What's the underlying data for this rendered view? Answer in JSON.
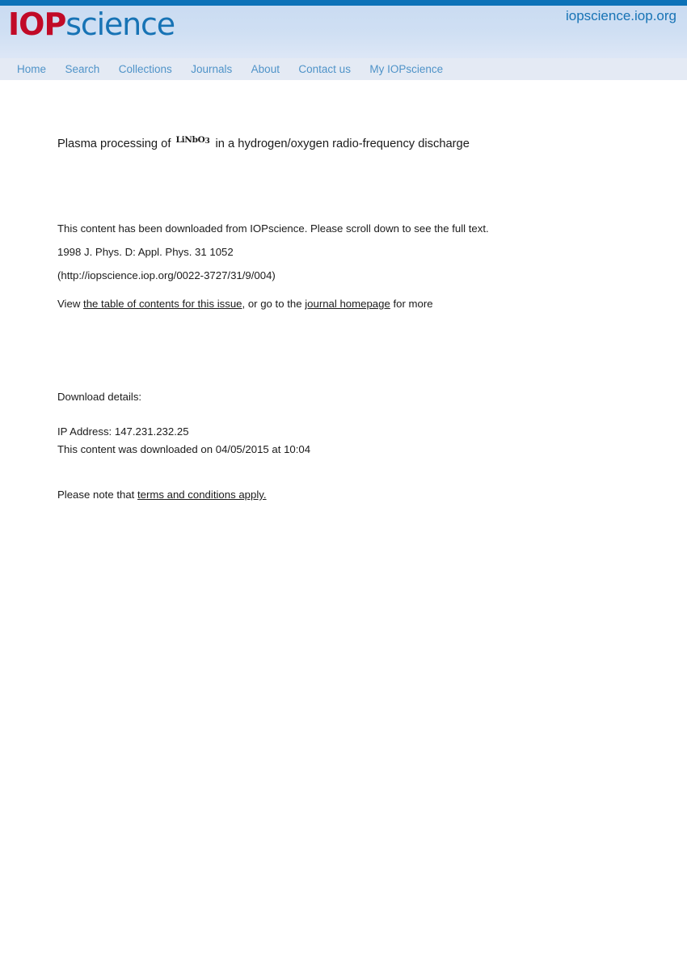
{
  "header": {
    "logo_primary": "IOP",
    "logo_secondary": "science",
    "site_url": "iopscience.iop.org",
    "top_rule_color": "#0c72b8",
    "band_color": "#cfdff3",
    "logo_primary_color": "#c10a27",
    "logo_secondary_color": "#1773b5"
  },
  "nav": {
    "link_color": "#4f93c8",
    "background_color": "#e4eaf4",
    "items": [
      {
        "label": "Home"
      },
      {
        "label": "Search"
      },
      {
        "label": "Collections"
      },
      {
        "label": "Journals"
      },
      {
        "label": "About"
      },
      {
        "label": "Contact us"
      },
      {
        "label": "My IOPscience"
      }
    ]
  },
  "article": {
    "title_before_formula": "Plasma processing of",
    "formula_main": "LiNbO",
    "formula_subscript": "3",
    "title_after_formula": "in a hydrogen/oxygen radio-frequency discharge"
  },
  "cover": {
    "downloaded_notice": "This content has been downloaded from IOPscience. Please scroll down to see the full text.",
    "citation": "1998 J. Phys. D: Appl. Phys. 31 1052",
    "doi_url": "(http://iopscience.iop.org/0022-3727/31/9/004)",
    "view_prefix": "View",
    "view_toc_link": "the table of contents for this issue",
    "view_middle": ", or go to the",
    "view_journal_link": "journal homepage",
    "view_suffix": "for more",
    "download_details_label": "Download details:",
    "ip_address": "IP Address: 147.231.232.25",
    "download_date": "This content was downloaded on 04/05/2015 at 10:04",
    "terms_prefix": "Please note that",
    "terms_link": "terms and conditions apply."
  }
}
